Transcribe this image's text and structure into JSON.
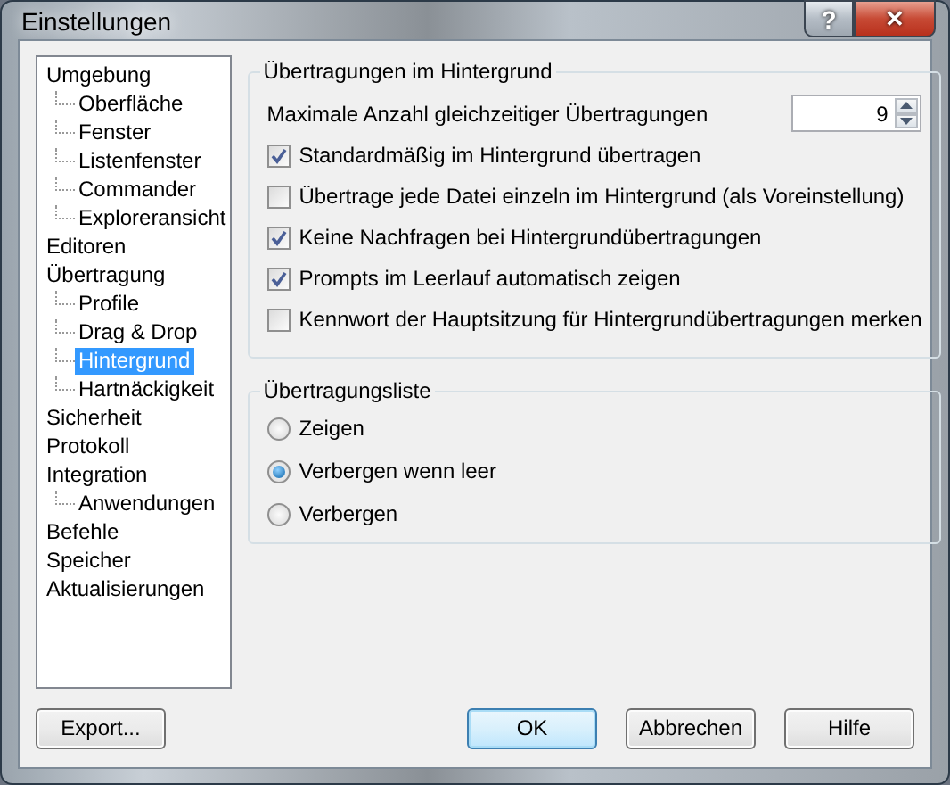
{
  "window": {
    "title": "Einstellungen",
    "help_button": "?",
    "close_button": "✕"
  },
  "tree": [
    {
      "label": "Umgebung",
      "selected": false,
      "children": [
        {
          "label": "Oberfläche",
          "selected": false
        },
        {
          "label": "Fenster",
          "selected": false
        },
        {
          "label": "Listenfenster",
          "selected": false
        },
        {
          "label": "Commander",
          "selected": false
        },
        {
          "label": "Exploreransicht",
          "selected": false
        }
      ]
    },
    {
      "label": "Editoren",
      "selected": false
    },
    {
      "label": "Übertragung",
      "selected": false,
      "children": [
        {
          "label": "Profile",
          "selected": false
        },
        {
          "label": "Drag & Drop",
          "selected": false
        },
        {
          "label": "Hintergrund",
          "selected": true
        },
        {
          "label": "Hartnäckigkeit",
          "selected": false
        }
      ]
    },
    {
      "label": "Sicherheit",
      "selected": false
    },
    {
      "label": "Protokoll",
      "selected": false
    },
    {
      "label": "Integration",
      "selected": false,
      "children": [
        {
          "label": "Anwendungen",
          "selected": false
        }
      ]
    },
    {
      "label": "Befehle",
      "selected": false
    },
    {
      "label": "Speicher",
      "selected": false
    },
    {
      "label": "Aktualisierungen",
      "selected": false
    }
  ],
  "background_group": {
    "title": "Übertragungen im Hintergrund",
    "max_transfers": {
      "label": "Maximale Anzahl gleichzeitiger Übertragungen",
      "value": "9"
    },
    "options": [
      {
        "label": "Standardmäßig im Hintergrund übertragen",
        "checked": true
      },
      {
        "label": "Übertrage jede Datei einzeln im Hintergrund (als Voreinstellung)",
        "checked": false
      },
      {
        "label": "Keine Nachfragen bei Hintergrundübertragungen",
        "checked": true
      },
      {
        "label": "Prompts im Leerlauf automatisch zeigen",
        "checked": true
      },
      {
        "label": "Kennwort der Hauptsitzung für Hintergrundübertragungen merken",
        "checked": false
      }
    ]
  },
  "list_group": {
    "title": "Übertragungsliste",
    "options": [
      {
        "label": "Zeigen",
        "selected": false
      },
      {
        "label": "Verbergen wenn leer",
        "selected": true
      },
      {
        "label": "Verbergen",
        "selected": false
      }
    ]
  },
  "buttons": [
    {
      "label": "Export...",
      "kind": "left"
    },
    {
      "label": "OK",
      "kind": "default"
    },
    {
      "label": "Abbrechen",
      "kind": "normal"
    },
    {
      "label": "Hilfe",
      "kind": "normal"
    }
  ]
}
